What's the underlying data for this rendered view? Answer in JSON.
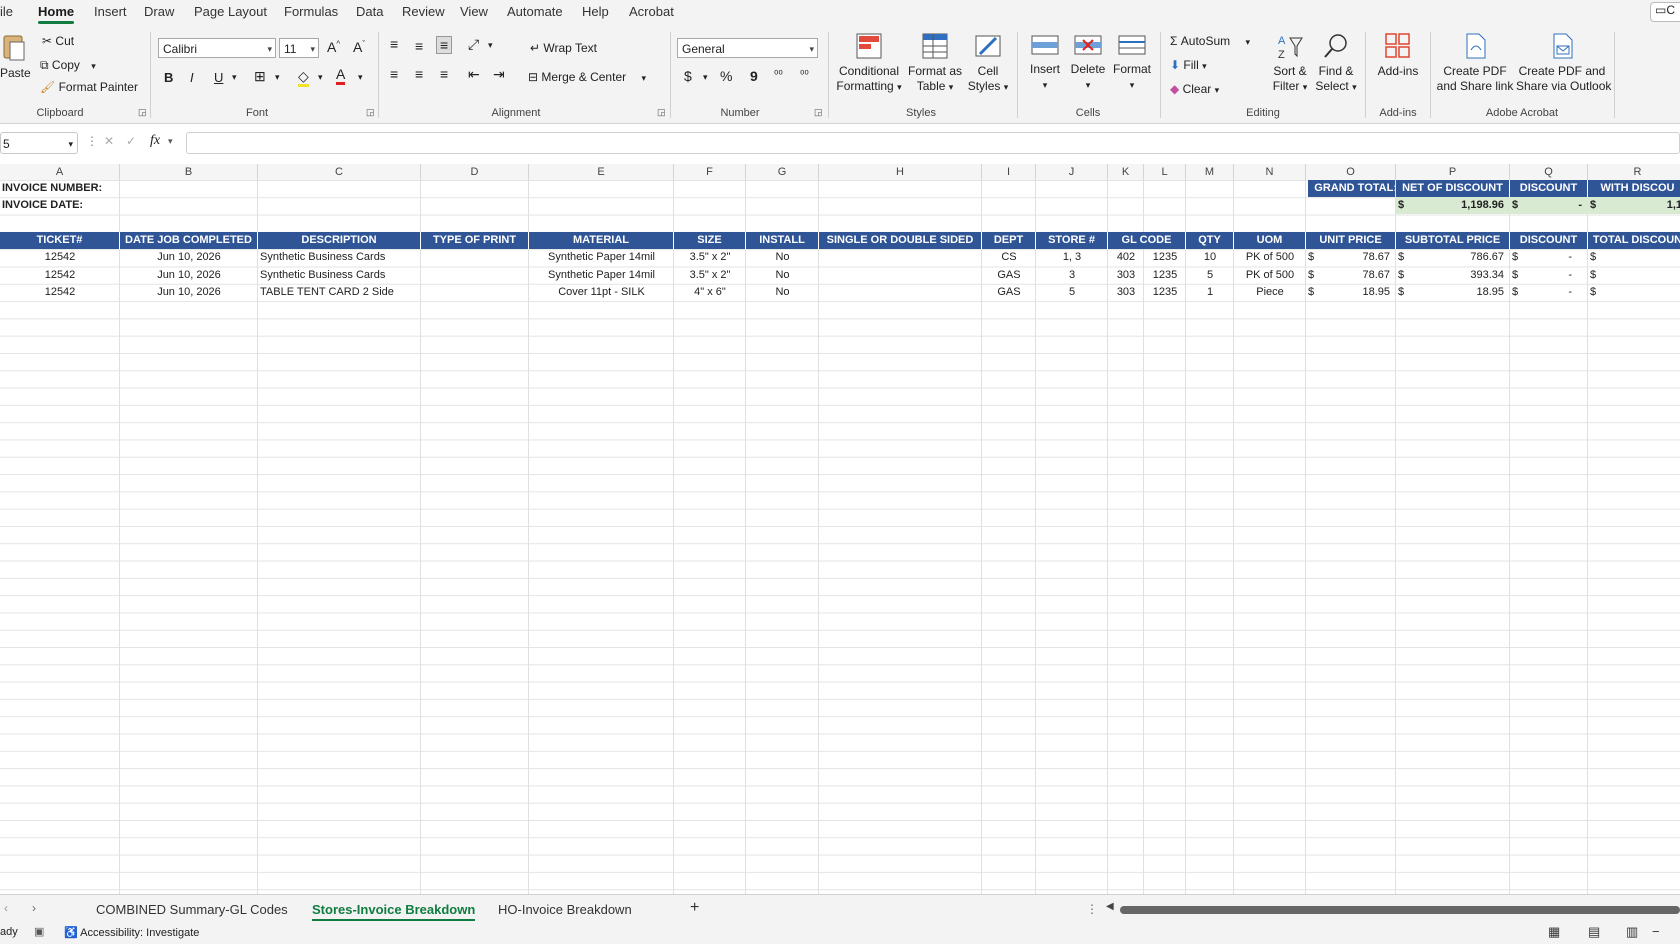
{
  "ribbon_tabs": [
    "ile",
    "Home",
    "Insert",
    "Draw",
    "Page Layout",
    "Formulas",
    "Data",
    "Review",
    "View",
    "Automate",
    "Help",
    "Acrobat"
  ],
  "comment_btn": "C",
  "clipboard": {
    "paste": "Paste",
    "cut": "Cut",
    "copy": "Copy",
    "format_painter": "Format Painter",
    "label": "Clipboard"
  },
  "font": {
    "family": "Calibri",
    "size": "11",
    "bold": "B",
    "italic": "I",
    "underline": "U",
    "label": "Font"
  },
  "alignment": {
    "wrap_text": "Wrap Text",
    "merge_center": "Merge & Center",
    "label": "Alignment"
  },
  "number": {
    "format": "General",
    "currency": "$",
    "percent": "%",
    "comma": "9",
    "label": "Number"
  },
  "styles": {
    "conditional": [
      "Conditional",
      "Formatting"
    ],
    "format_table": [
      "Format as",
      "Table"
    ],
    "cell_styles": [
      "Cell",
      "Styles"
    ],
    "label": "Styles"
  },
  "cells": {
    "insert": "Insert",
    "delete": "Delete",
    "format": "Format",
    "label": "Cells"
  },
  "editing": {
    "autosum": "AutoSum",
    "fill": "Fill",
    "clear": "Clear",
    "sort": [
      "Sort &",
      "Filter"
    ],
    "find": [
      "Find &",
      "Select"
    ],
    "label": "Editing"
  },
  "addins": {
    "addins": "Add-ins",
    "label": "Add-ins"
  },
  "acrobat": {
    "create_pdf_link": [
      "Create PDF",
      "and Share link"
    ],
    "create_pdf_outlook": [
      "Create PDF and",
      "Share via Outlook"
    ],
    "label": "Adobe Acrobat"
  },
  "formula_bar": {
    "name_box": "5",
    "fx": "fx",
    "value": ""
  },
  "columns": [
    "A",
    "B",
    "C",
    "D",
    "E",
    "F",
    "G",
    "H",
    "I",
    "J",
    "K",
    "L",
    "M",
    "N",
    "O",
    "P",
    "Q",
    "R"
  ],
  "labels": {
    "invoice_number": "INVOICE NUMBER:",
    "invoice_date": "INVOICE DATE:",
    "grand_total": "GRAND TOTAL:"
  },
  "totals_header": [
    "NET OF DISCOUNT",
    "DISCOUNT",
    "WITH DISCOU"
  ],
  "totals_values": [
    {
      "cur": "$",
      "val": "1,198.96"
    },
    {
      "cur": "$",
      "val": "-"
    },
    {
      "cur": "$",
      "val": "1,1"
    }
  ],
  "table_headers": [
    "TICKET#",
    "DATE JOB COMPLETED",
    "DESCRIPTION",
    "TYPE OF PRINT",
    "MATERIAL",
    "SIZE",
    "INSTALL",
    "SINGLE OR DOUBLE SIDED",
    "DEPT",
    "STORE #",
    "GL CODE",
    "",
    "QTY",
    "UOM",
    "UNIT PRICE",
    "SUBTOTAL PRICE",
    "DISCOUNT",
    "TOTAL DISCOUN"
  ],
  "rows": [
    [
      "12542",
      "Jun 10, 2026",
      "Synthetic Business Cards",
      "",
      "Synthetic Paper 14mil",
      "3.5\" x 2\"",
      "No",
      "",
      "CS",
      "1, 3",
      "402",
      "1235",
      "10",
      "PK of 500",
      "78.67",
      "786.67",
      "-",
      ""
    ],
    [
      "12542",
      "Jun 10, 2026",
      "Synthetic Business Cards",
      "",
      "Synthetic Paper 14mil",
      "3.5\" x 2\"",
      "No",
      "",
      "GAS",
      "3",
      "303",
      "1235",
      "5",
      "PK of 500",
      "78.67",
      "393.34",
      "-",
      ""
    ],
    [
      "12542",
      "Jun 10, 2026",
      "TABLE TENT CARD 2 Side",
      "",
      "Cover 11pt - SILK",
      "4\" x 6\"",
      "No",
      "",
      "GAS",
      "5",
      "303",
      "1235",
      "1",
      "Piece",
      "18.95",
      "18.95",
      "-",
      ""
    ]
  ],
  "currency_symbol": "$",
  "sheet_tabs": [
    "COMBINED Summary-GL Codes",
    "Stores-Invoice Breakdown",
    "HO-Invoice Breakdown"
  ],
  "add_sheet": "+",
  "status": {
    "ready": "ady",
    "accessibility": "Accessibility: Investigate"
  },
  "colors": {
    "header_blue": "#2f5597",
    "total_green": "#d9ead3",
    "excel_green": "#107c41"
  }
}
